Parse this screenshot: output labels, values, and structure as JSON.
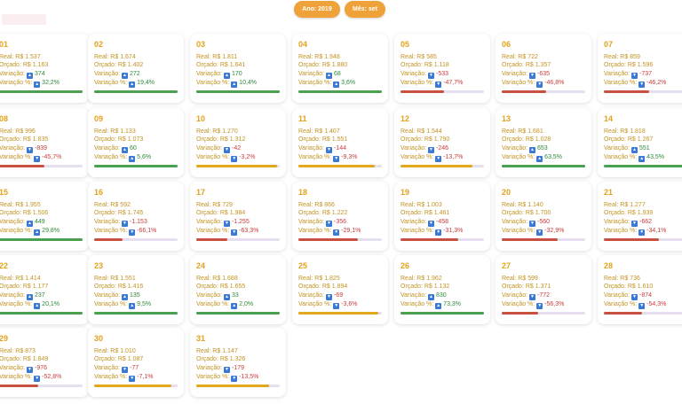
{
  "filters": {
    "year": "Ano: 2019",
    "month": "Mês: set"
  },
  "colors": {
    "good": "#4aa14f",
    "warn": "#e0a81a",
    "bad": "#c7503e",
    "track": "#e5dff0"
  },
  "labels": {
    "real": "Real: ",
    "budget": "Orçado: ",
    "variation": "Variação: ",
    "variation_pct": "Variação %: "
  },
  "days": [
    {
      "day": "01",
      "real": "R$ 1.537",
      "budget": "R$ 1.163",
      "variation": "374",
      "pct": "32,2%",
      "dir": "up",
      "bar": "good",
      "fill": 1.0
    },
    {
      "day": "02",
      "real": "R$ 1.674",
      "budget": "R$ 1.402",
      "variation": "272",
      "pct": "19,4%",
      "dir": "up",
      "bar": "good",
      "fill": 1.0
    },
    {
      "day": "03",
      "real": "R$ 1.811",
      "budget": "R$ 1.641",
      "variation": "170",
      "pct": "10,4%",
      "dir": "up",
      "bar": "good",
      "fill": 1.0
    },
    {
      "day": "04",
      "real": "R$ 1.948",
      "budget": "R$ 1.880",
      "variation": "68",
      "pct": "3,6%",
      "dir": "up",
      "bar": "good",
      "fill": 1.0
    },
    {
      "day": "05",
      "real": "R$ 585",
      "budget": "R$ 1.118",
      "variation": "-533",
      "pct": "-47,7%",
      "dir": "down",
      "bar": "bad",
      "fill": 0.52
    },
    {
      "day": "06",
      "real": "R$ 722",
      "budget": "R$ 1.357",
      "variation": "-635",
      "pct": "-46,8%",
      "dir": "down",
      "bar": "bad",
      "fill": 0.53
    },
    {
      "day": "07",
      "real": "R$ 859",
      "budget": "R$ 1.596",
      "variation": "-737",
      "pct": "-46,2%",
      "dir": "down",
      "bar": "bad",
      "fill": 0.54
    },
    {
      "day": "08",
      "real": "R$ 996",
      "budget": "R$ 1.835",
      "variation": "-839",
      "pct": "-45,7%",
      "dir": "down",
      "bar": "bad",
      "fill": 0.54
    },
    {
      "day": "09",
      "real": "R$ 1.133",
      "budget": "R$ 1.073",
      "variation": "60",
      "pct": "5,6%",
      "dir": "up",
      "bar": "good",
      "fill": 1.0
    },
    {
      "day": "10",
      "real": "R$ 1.270",
      "budget": "R$ 1.312",
      "variation": "-42",
      "pct": "-3,2%",
      "dir": "down",
      "bar": "warn",
      "fill": 0.97
    },
    {
      "day": "11",
      "real": "R$ 1.407",
      "budget": "R$ 1.551",
      "variation": "-144",
      "pct": "-9,3%",
      "dir": "down",
      "bar": "warn",
      "fill": 0.91
    },
    {
      "day": "12",
      "real": "R$ 1.544",
      "budget": "R$ 1.790",
      "variation": "-246",
      "pct": "-13,7%",
      "dir": "down",
      "bar": "warn",
      "fill": 0.86
    },
    {
      "day": "13",
      "real": "R$ 1.681",
      "budget": "R$ 1.028",
      "variation": "653",
      "pct": "63,5%",
      "dir": "up",
      "bar": "good",
      "fill": 1.0
    },
    {
      "day": "14",
      "real": "R$ 1.818",
      "budget": "R$ 1.267",
      "variation": "551",
      "pct": "43,5%",
      "dir": "up",
      "bar": "good",
      "fill": 1.0
    },
    {
      "day": "15",
      "real": "R$ 1.955",
      "budget": "R$ 1.506",
      "variation": "449",
      "pct": "29,8%",
      "dir": "up",
      "bar": "good",
      "fill": 1.0
    },
    {
      "day": "16",
      "real": "R$ 592",
      "budget": "R$ 1.745",
      "variation": "-1.153",
      "pct": "-66,1%",
      "dir": "down",
      "bar": "bad",
      "fill": 0.34
    },
    {
      "day": "17",
      "real": "R$ 729",
      "budget": "R$ 1.984",
      "variation": "-1.255",
      "pct": "-63,3%",
      "dir": "down",
      "bar": "bad",
      "fill": 0.37
    },
    {
      "day": "18",
      "real": "R$ 866",
      "budget": "R$ 1.222",
      "variation": "-356",
      "pct": "-29,1%",
      "dir": "down",
      "bar": "bad",
      "fill": 0.71
    },
    {
      "day": "19",
      "real": "R$ 1.003",
      "budget": "R$ 1.461",
      "variation": "-458",
      "pct": "-31,3%",
      "dir": "down",
      "bar": "bad",
      "fill": 0.69
    },
    {
      "day": "20",
      "real": "R$ 1.140",
      "budget": "R$ 1.700",
      "variation": "-560",
      "pct": "-32,9%",
      "dir": "down",
      "bar": "bad",
      "fill": 0.67
    },
    {
      "day": "21",
      "real": "R$ 1.277",
      "budget": "R$ 1.939",
      "variation": "-662",
      "pct": "-34,1%",
      "dir": "down",
      "bar": "bad",
      "fill": 0.66
    },
    {
      "day": "22",
      "real": "R$ 1.414",
      "budget": "R$ 1.177",
      "variation": "237",
      "pct": "20,1%",
      "dir": "up",
      "bar": "good",
      "fill": 1.0
    },
    {
      "day": "23",
      "real": "R$ 1.551",
      "budget": "R$ 1.416",
      "variation": "135",
      "pct": "9,5%",
      "dir": "up",
      "bar": "good",
      "fill": 1.0
    },
    {
      "day": "24",
      "real": "R$ 1.688",
      "budget": "R$ 1.655",
      "variation": "33",
      "pct": "2,0%",
      "dir": "up",
      "bar": "good",
      "fill": 1.0
    },
    {
      "day": "25",
      "real": "R$ 1.825",
      "budget": "R$ 1.894",
      "variation": "-69",
      "pct": "-3,6%",
      "dir": "down",
      "bar": "warn",
      "fill": 0.96
    },
    {
      "day": "26",
      "real": "R$ 1.962",
      "budget": "R$ 1.132",
      "variation": "830",
      "pct": "73,3%",
      "dir": "up",
      "bar": "good",
      "fill": 1.0
    },
    {
      "day": "27",
      "real": "R$ 599",
      "budget": "R$ 1.371",
      "variation": "-772",
      "pct": "-56,3%",
      "dir": "down",
      "bar": "bad",
      "fill": 0.44
    },
    {
      "day": "28",
      "real": "R$ 736",
      "budget": "R$ 1.610",
      "variation": "-874",
      "pct": "-54,3%",
      "dir": "down",
      "bar": "bad",
      "fill": 0.46
    },
    {
      "day": "29",
      "real": "R$ 873",
      "budget": "R$ 1.849",
      "variation": "-976",
      "pct": "-52,8%",
      "dir": "down",
      "bar": "bad",
      "fill": 0.47
    },
    {
      "day": "30",
      "real": "R$ 1.010",
      "budget": "R$ 1.087",
      "variation": "-77",
      "pct": "-7,1%",
      "dir": "down",
      "bar": "warn",
      "fill": 0.93
    },
    {
      "day": "31",
      "real": "R$ 1.147",
      "budget": "R$ 1.326",
      "variation": "-179",
      "pct": "-13,5%",
      "dir": "down",
      "bar": "warn",
      "fill": 0.87
    }
  ]
}
